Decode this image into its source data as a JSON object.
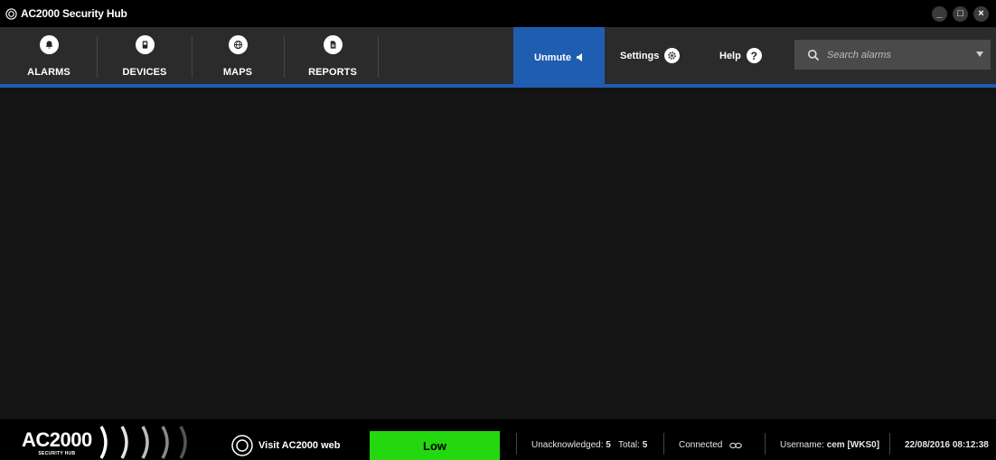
{
  "window": {
    "title": "AC2000 Security Hub",
    "controls": [
      "_",
      "□",
      "×"
    ]
  },
  "nav": {
    "items": [
      {
        "label": "ALARMS",
        "icon": "bell-icon"
      },
      {
        "label": "DEVICES",
        "icon": "device-icon"
      },
      {
        "label": "MAPS",
        "icon": "globe-icon"
      },
      {
        "label": "REPORTS",
        "icon": "document-icon"
      }
    ]
  },
  "toolbar": {
    "unmute_label": "Unmute",
    "unmute_icon": "speaker-icon",
    "settings_label": "Settings",
    "settings_icon": "gear-icon",
    "help_label": "Help",
    "help_glyph": "?"
  },
  "search": {
    "placeholder": "Search alarms",
    "value": ""
  },
  "footer": {
    "brand_main": "AC2000",
    "brand_sub": "SECURITY HUB",
    "visit_label": "Visit AC2000 web",
    "level": "Low",
    "unack_label": "Unacknowledged:",
    "unack_value": "5",
    "total_label": "Total:",
    "total_value": "5",
    "connection": "Connected",
    "username_label": "Username:",
    "username_value": "cem [WKS0]",
    "datetime": "22/08/2016 08:12:38"
  },
  "colors": {
    "accent": "#1f5db1",
    "level_low": "#23d80f",
    "navbar": "#2b2b2b",
    "content": "#141414"
  }
}
